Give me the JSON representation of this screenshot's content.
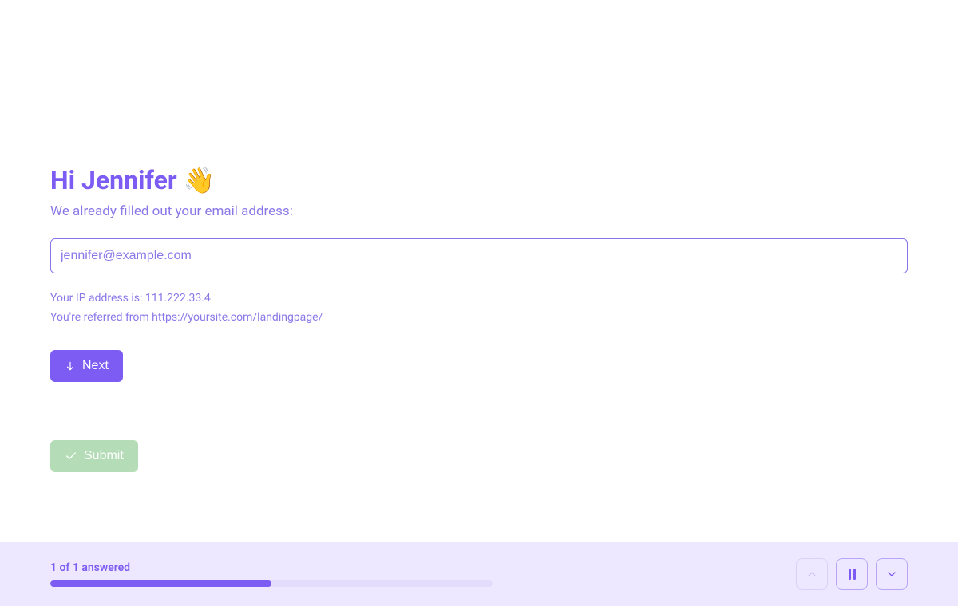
{
  "header": {
    "greeting": "Hi Jennifer",
    "wave_emoji": "👋",
    "subtitle": "We already filled out your email address:"
  },
  "email": {
    "value": "jennifer@example.com"
  },
  "info": {
    "ip_line": "Your IP address is: 111.222.33.4",
    "referrer_line": "You're referred from https://yoursite.com/landingpage/"
  },
  "buttons": {
    "next": "Next",
    "submit": "Submit"
  },
  "footer": {
    "progress_text": "1 of 1 answered",
    "progress_pct": 50
  }
}
